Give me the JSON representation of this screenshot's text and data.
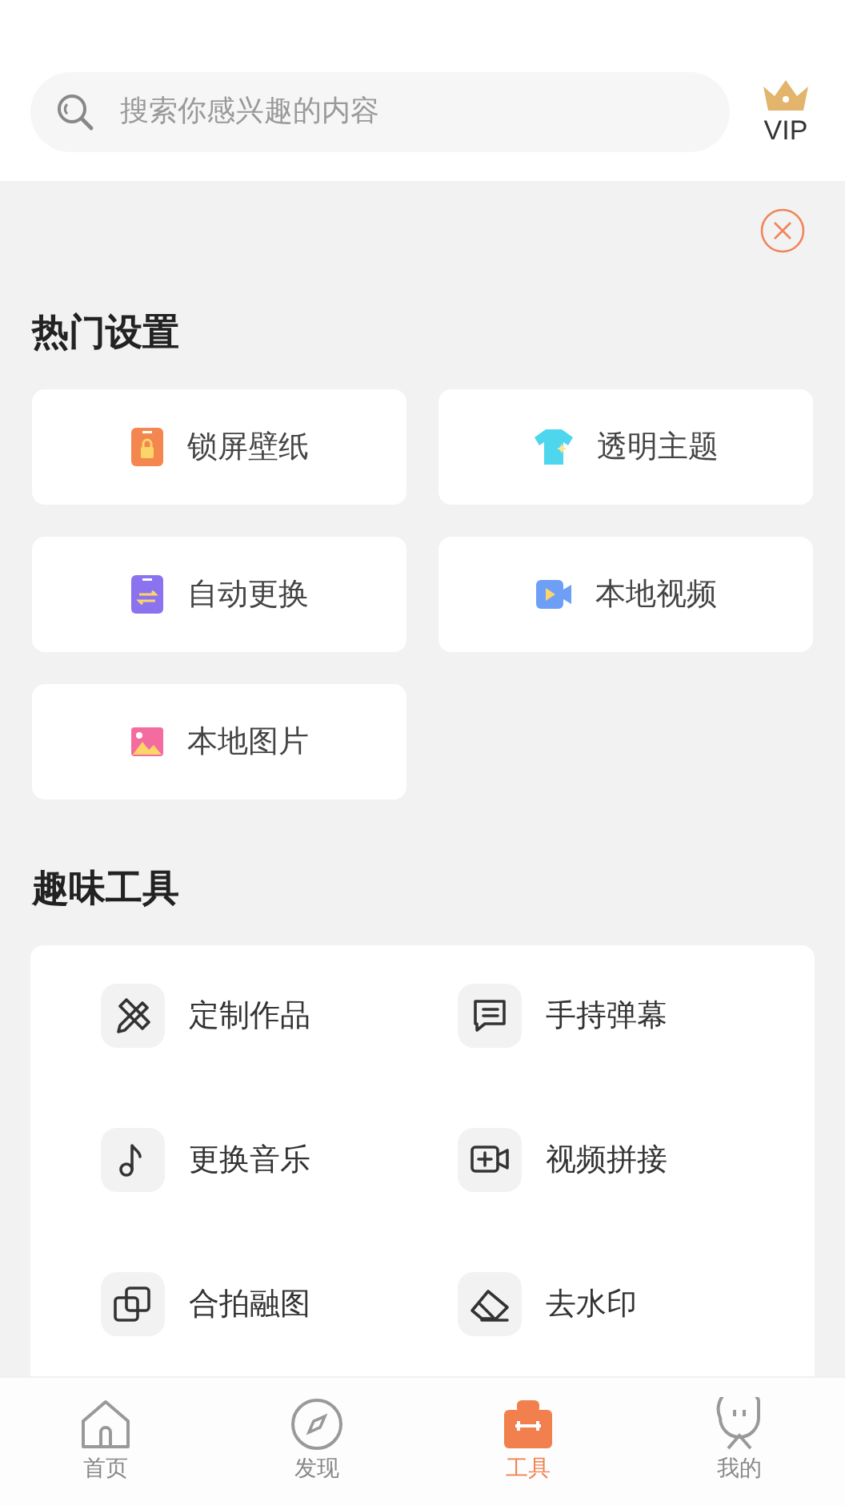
{
  "search": {
    "placeholder": "搜索你感兴趣的内容"
  },
  "vip": {
    "label": "VIP"
  },
  "hot_settings": {
    "title": "热门设置",
    "items": [
      {
        "label": "锁屏壁纸"
      },
      {
        "label": "透明主题"
      },
      {
        "label": "自动更换"
      },
      {
        "label": "本地视频"
      },
      {
        "label": "本地图片"
      }
    ]
  },
  "fun_tools": {
    "title": "趣味工具",
    "items": [
      {
        "label": "定制作品"
      },
      {
        "label": "手持弹幕"
      },
      {
        "label": "更换音乐"
      },
      {
        "label": "视频拼接"
      },
      {
        "label": "合拍融图"
      },
      {
        "label": "去水印"
      }
    ]
  },
  "tab_bar": [
    {
      "label": "首页",
      "selected": false
    },
    {
      "label": "发现",
      "selected": false
    },
    {
      "label": "工具",
      "selected": true
    },
    {
      "label": "我的",
      "selected": false
    }
  ]
}
